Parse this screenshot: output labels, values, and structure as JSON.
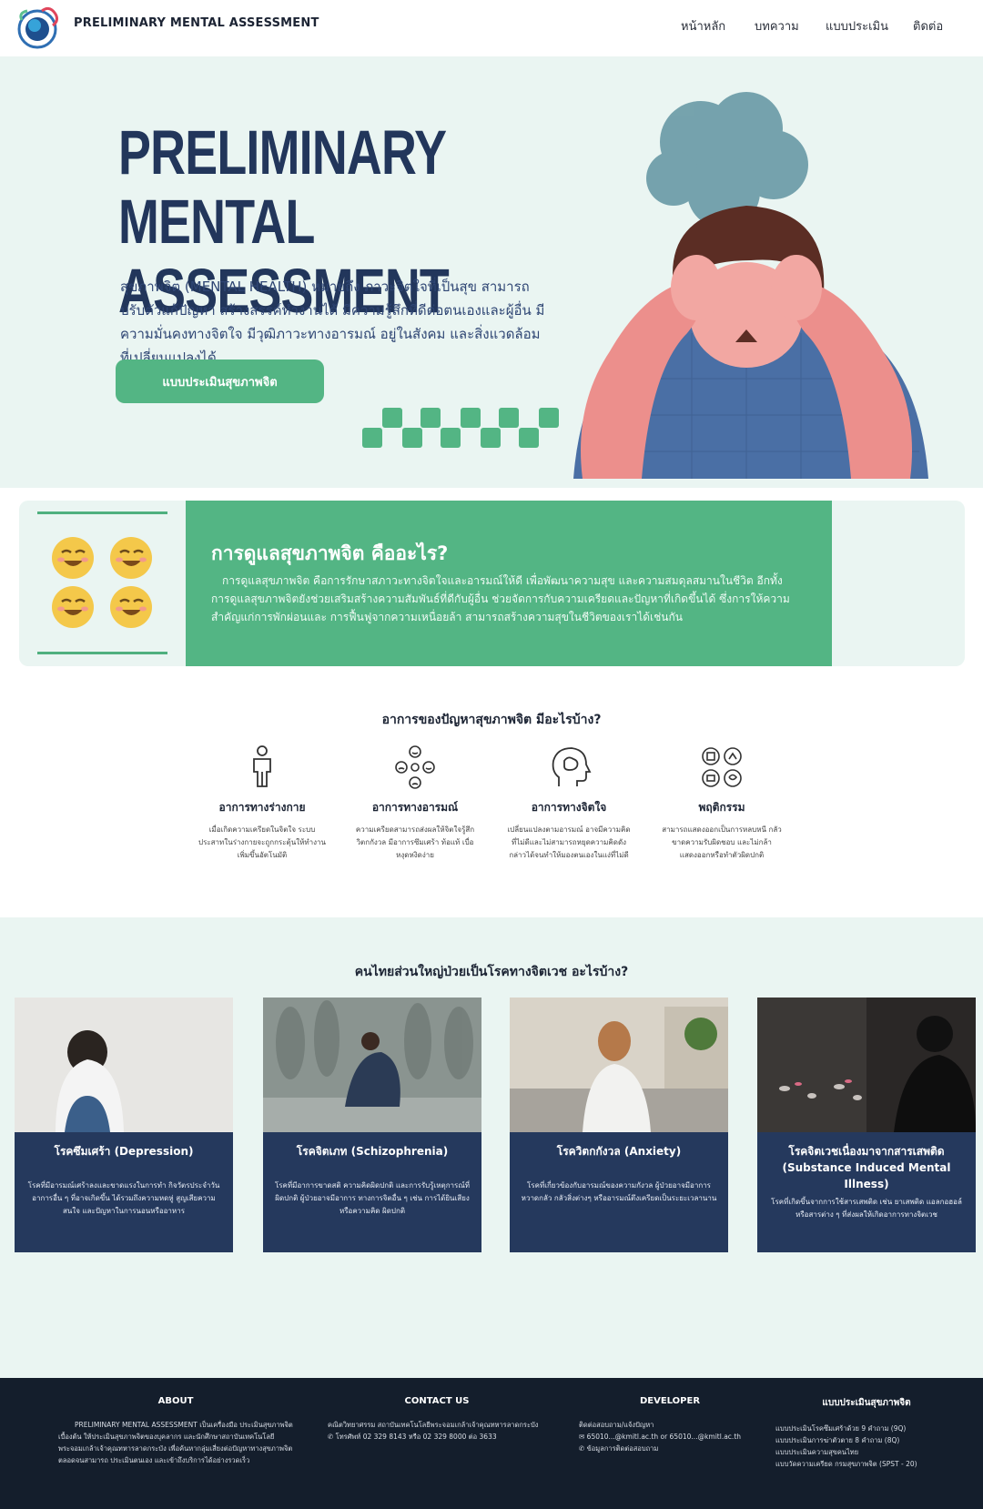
{
  "header": {
    "brand": "PRELIMINARY MENTAL ASSESSMENT",
    "nav": [
      "หน้าหลัก",
      "บทความ",
      "แบบประเมิน",
      "ติดต่อ"
    ]
  },
  "hero": {
    "title_line1": "PRELIMINARY MENTAL",
    "title_line2": "ASSESSMENT",
    "description": "สุขภาพจิต (MENTAL HEALTH) หมายถึง ภาวะจิตใจที่เป็นสุข สามารถปรับตัวแก้ปัญหา สร้างสรรค์ทำงานได้ มีความรู้สึกที่ดีต่อตนเองและผู้อื่น มีความมั่นคงทางจิตใจ มีวุฒิภาวะทางอารมณ์ อยู่ในสังคม และสิ่งแวดล้อมที่เปลี่ยนแปลงได้",
    "button": "แบบประเมินสุขภาพจิต"
  },
  "care": {
    "title": "การดูแลสุขภาพจิต คืออะไร?",
    "text": "การดูแลสุขภาพจิต คือการรักษาสภาวะทางจิตใจและอารมณ์ให้ดี เพื่อพัฒนาความสุข และความสมดุลสมานในชีวิต อีกทั้งการดูแลสุขภาพจิตยังช่วยเสริมสร้างความสัมพันธ์ที่ดีกับผู้อื่น ช่วยจัดการกับความเครียดและปัญหาที่เกิดขึ้นได้ ซึ่งการให้ความสำคัญแก่การพักผ่อนและ การฟื้นฟูจากความเหนื่อยล้า สามารถสร้างความสุขในชีวิตของเราได้เช่นกัน"
  },
  "symptoms": {
    "heading": "อาการของปัญหาสุขภาพจิต มีอะไรบ้าง?",
    "items": [
      {
        "icon": "person-icon",
        "title": "อาการทางร่างกาย",
        "text": "เมื่อเกิดความเครียดในจิตใจ ระบบประสาทในร่างกายจะถูกกระตุ้นให้ทำงานเพิ่มขึ้นอัตโนมัติ"
      },
      {
        "icon": "emotions-icon",
        "title": "อาการทางอารมณ์",
        "text": "ความเครียดสามารถส่งผลให้จิตใจรู้สึกวิตกกังวล มีอาการซึมเศร้า ท้อแท้ เบื่อ หงุดหงิดง่าย"
      },
      {
        "icon": "brain-head-icon",
        "title": "อาการทางจิตใจ",
        "text": "เปลี่ยนแปลงตามอารมณ์ อาจมีความคิดที่ไม่ดีและไม่สามารถหยุดความคิดดังกล่าวได้จนทำให้มองตนเองในแง่ที่ไม่ดี"
      },
      {
        "icon": "behavior-icon",
        "title": "พฤติกรรม",
        "text": "สามารถแสดงออกเป็นการหลบหนี กลัว ขาดความรับผิดชอบ และไม่กล้าแสดงออกหรือทำตัวผิดปกติ"
      }
    ]
  },
  "diseases": {
    "heading": "คนไทยส่วนใหญ่ป่วยเป็นโรคทางจิตเวช อะไรบ้าง?",
    "cards": [
      {
        "title": "โรคซึมเศร้า (Depression)",
        "text": "โรคที่มีอารมณ์เศร้าลงและขาดแรงในการทำ กิจวัตรประจำวัน อาการอื่น ๆ ที่อาจเกิดขึ้น ได้รวมถึงความหดหู่ สูญเสียความสนใจ และปัญหาในการนอนหรืออาหาร"
      },
      {
        "title": "โรคจิตเภท (Schizophrenia)",
        "text": "โรคที่มีอาการขาดสติ ความคิดผิดปกติ และการรับรู้เหตุการณ์ที่ผิดปกติ ผู้ป่วยอาจมีอาการ ทางการจิตอื่น ๆ เช่น การได้ยินเสียงหรือความคิด ผิดปกติ"
      },
      {
        "title": "โรควิตกกังวล (Anxiety)",
        "text": "โรคที่เกี่ยวข้องกับอารมณ์ของความกังวล ผู้ป่วยอาจมีอาการหวาดกลัว กลัวสิ่งต่างๆ หรืออารมณ์ตึงเครียดเป็นระยะเวลานาน"
      },
      {
        "title": "โรคจิตเวชเนื่องมาจากสารเสพติด (Substance Induced Mental Illness)",
        "text": "โรคที่เกิดขึ้นจากการใช้สารเสพติด เช่น ยาเสพติด แอลกอฮอล์ หรือสารต่าง ๆ ที่ส่งผลให้เกิดอาการทางจิตเวช"
      }
    ]
  },
  "footer": {
    "about": {
      "heading": "ABOUT",
      "text": "PRELIMINARY MENTAL ASSESSMENT เป็นเครื่องมือ ประเมินสุขภาพจิตเบื้องต้น ให้ประเมินสุขภาพจิตของบุคลากร และนักศึกษาสถาบันเทคโนโลยีพระจอมเกล้าเจ้าคุณทหารลาดกระบัง เพื่อค้นหากลุ่มเสี่ยงต่อปัญหาทางสุขภาพจิต ตลอดจนสามารถ ประเมินตนเอง และเข้าถึงบริการได้อย่างรวดเร็ว"
    },
    "contact": {
      "heading": "CONTACT US",
      "line1": "คณิตวิทยาศรรม สถาบันเทคโนโลยีพระจอมเกล้าเจ้าคุณทหารลาดกระบัง",
      "line2": "โทรศัพท์ 02 329 8143 หรือ 02 329 8000 ต่อ 3633"
    },
    "developer": {
      "heading": "DEVELOPER",
      "line1": "ติดต่อสอบถาม/แจ้งปัญหา",
      "line2": "65010...@kmitl.ac.th or 65010...@kmitl.ac.th",
      "line3": "ข้อมูลการติดต่อสอบถาม"
    },
    "assess": {
      "heading": "แบบประเมินสุขภาพจิต",
      "items": [
        "แบบประเมินโรคซึมเศร้าด้วย 9 คำถาม (9Q)",
        "แบบประเมินการฆ่าตัวตาย 8 คำถาม (8Q)",
        "แบบประเมินความสุขคนไทย",
        "แบบวัดความเครียด กรมสุขภาพจิต (SPST - 20)"
      ]
    }
  },
  "colors": {
    "primary_green": "#53b584",
    "navy": "#22365b",
    "mint_bg": "#eaf5f2",
    "footer_bg": "#141e2c"
  }
}
